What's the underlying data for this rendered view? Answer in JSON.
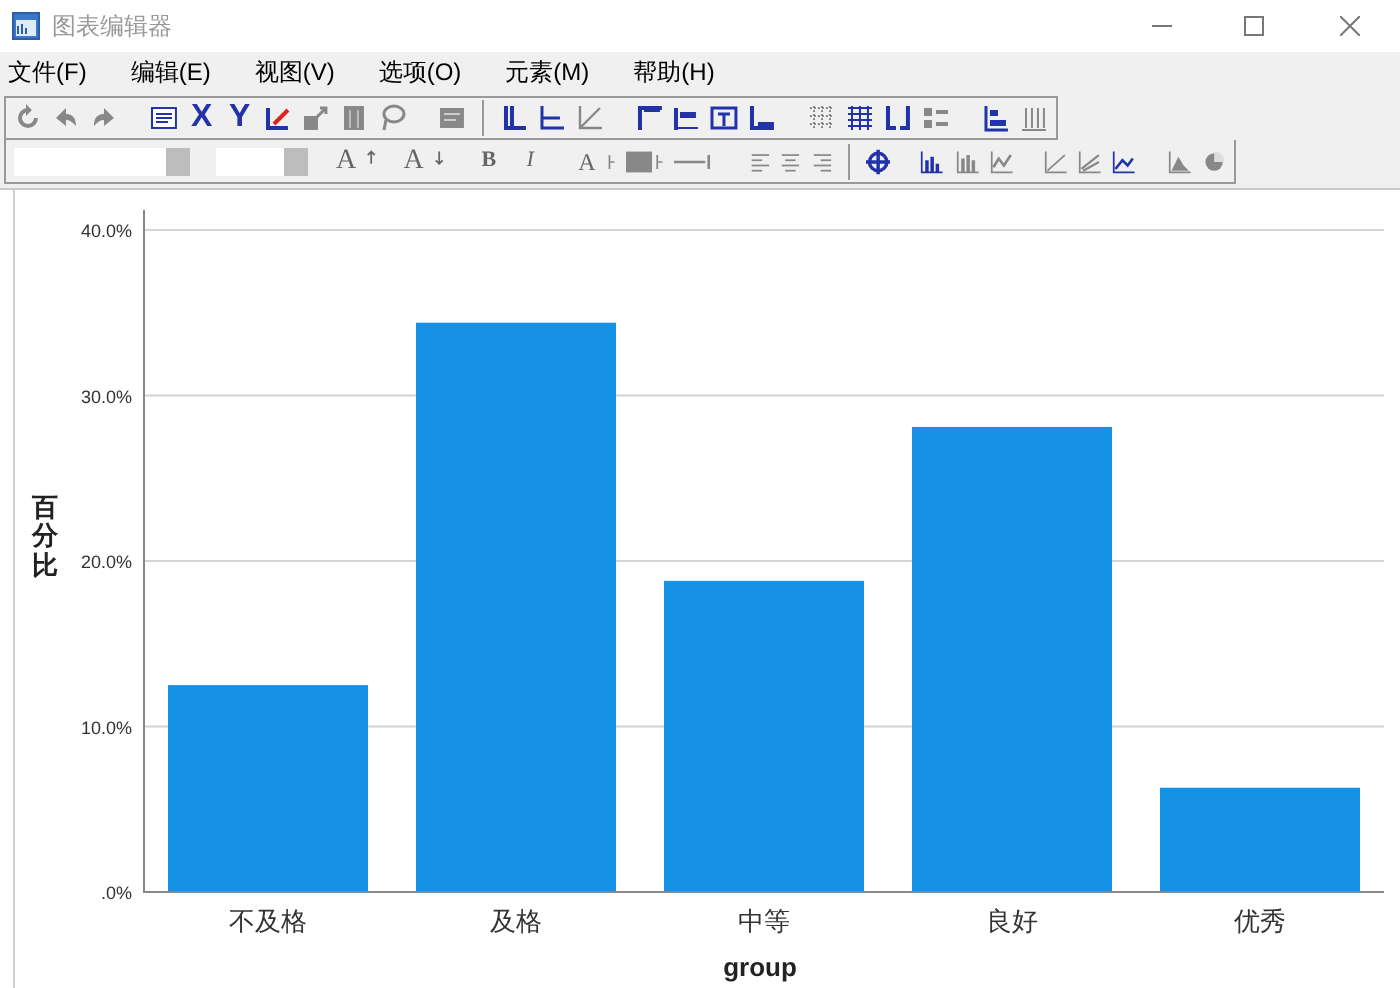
{
  "window": {
    "title": "图表编辑器"
  },
  "menu": [
    "文件(F)",
    "编辑(E)",
    "视图(V)",
    "选项(O)",
    "元素(M)",
    "帮助(H)"
  ],
  "toolbar": {
    "axis_buttons": [
      "X",
      "Y"
    ]
  },
  "format_toolbar": {
    "grow_font": "A",
    "shrink_font": "A",
    "bold": "B",
    "italic": "I",
    "text_color": "A"
  },
  "chart_data": {
    "type": "bar",
    "xlabel": "group",
    "ylabel": "百分比",
    "categories": [
      "不及格",
      "及格",
      "中等",
      "良好",
      "优秀"
    ],
    "values": [
      12.5,
      34.4,
      18.8,
      28.1,
      6.3
    ],
    "ylim": [
      0,
      40
    ],
    "yticks": [
      {
        "value": 0,
        "label": ".0%"
      },
      {
        "value": 10,
        "label": "10.0%"
      },
      {
        "value": 20,
        "label": "20.0%"
      },
      {
        "value": 30,
        "label": "30.0%"
      },
      {
        "value": 40,
        "label": "40.0%"
      }
    ],
    "grid": true,
    "color": "#1591e6"
  }
}
